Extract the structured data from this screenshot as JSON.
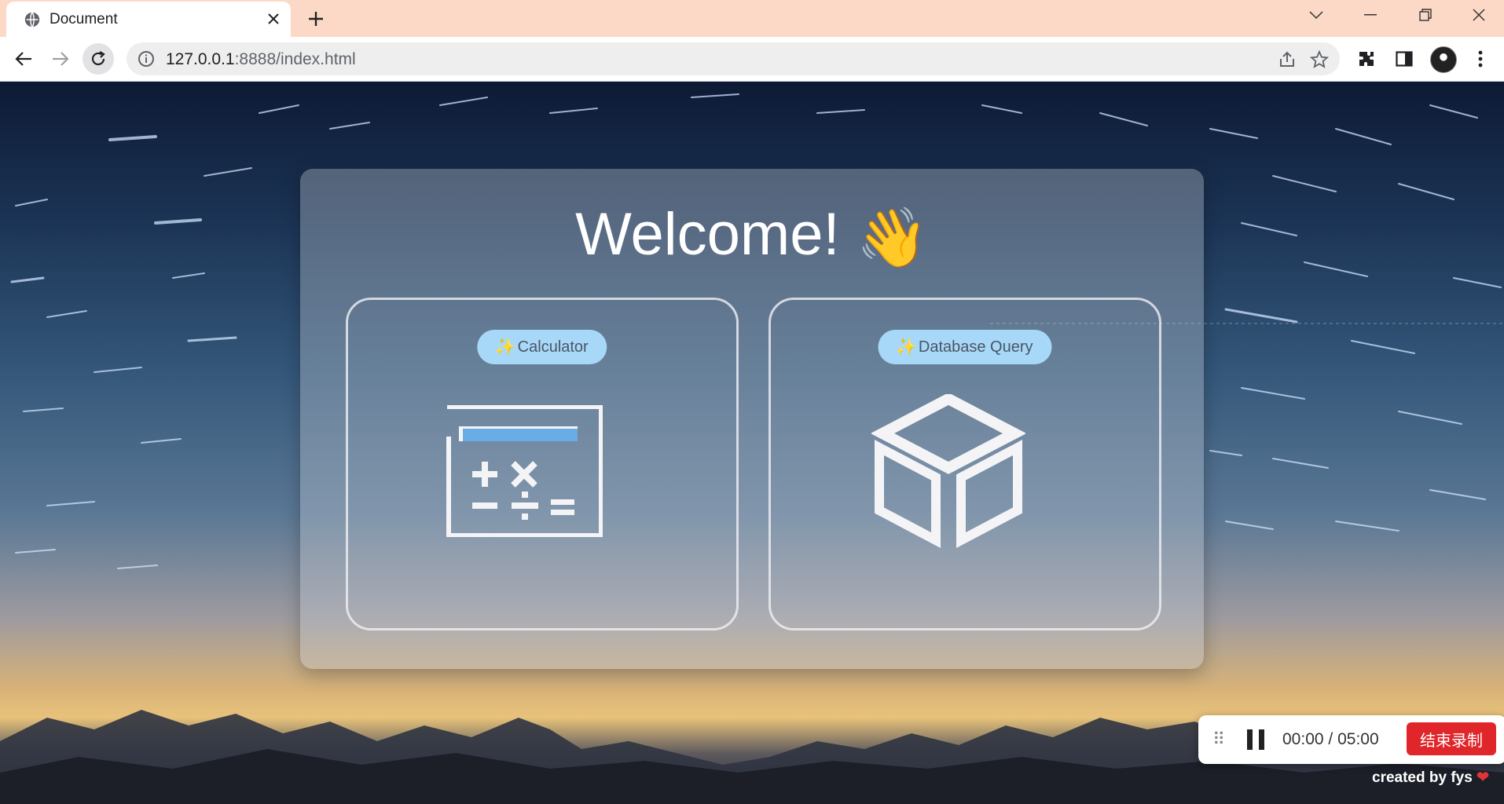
{
  "browser": {
    "tab_title": "Document",
    "new_tab_symbol": "+",
    "url_host": "127.0.0.1",
    "url_rest": ":8888/index.html",
    "icons": [
      "globe-icon",
      "close-icon",
      "back-icon",
      "forward-icon",
      "reload-icon",
      "info-icon",
      "share-icon",
      "star-icon",
      "extensions-icon",
      "side-panel-icon",
      "avatar",
      "more-icon",
      "minimize-icon",
      "restore-icon",
      "window-close-icon",
      "tab-search-icon"
    ]
  },
  "page": {
    "heading": "Welcome!",
    "heading_emoji": "👋",
    "cards": [
      {
        "label": "Calculator",
        "sparkle": "✨",
        "icon": "calculator-icon"
      },
      {
        "label": "Database Query",
        "sparkle": "✨",
        "icon": "cube-icon"
      }
    ]
  },
  "recorder": {
    "time_elapsed": "00:00",
    "time_separator": "/",
    "time_total": "05:00",
    "stop_label": "结束录制",
    "credit": "created by fys",
    "credit_heart": "❤"
  },
  "colors": {
    "tabbar": "#fcd9c7",
    "pill": "#a8d8f8",
    "stop_button": "#e0262a",
    "calc_display": "#6aace6"
  }
}
